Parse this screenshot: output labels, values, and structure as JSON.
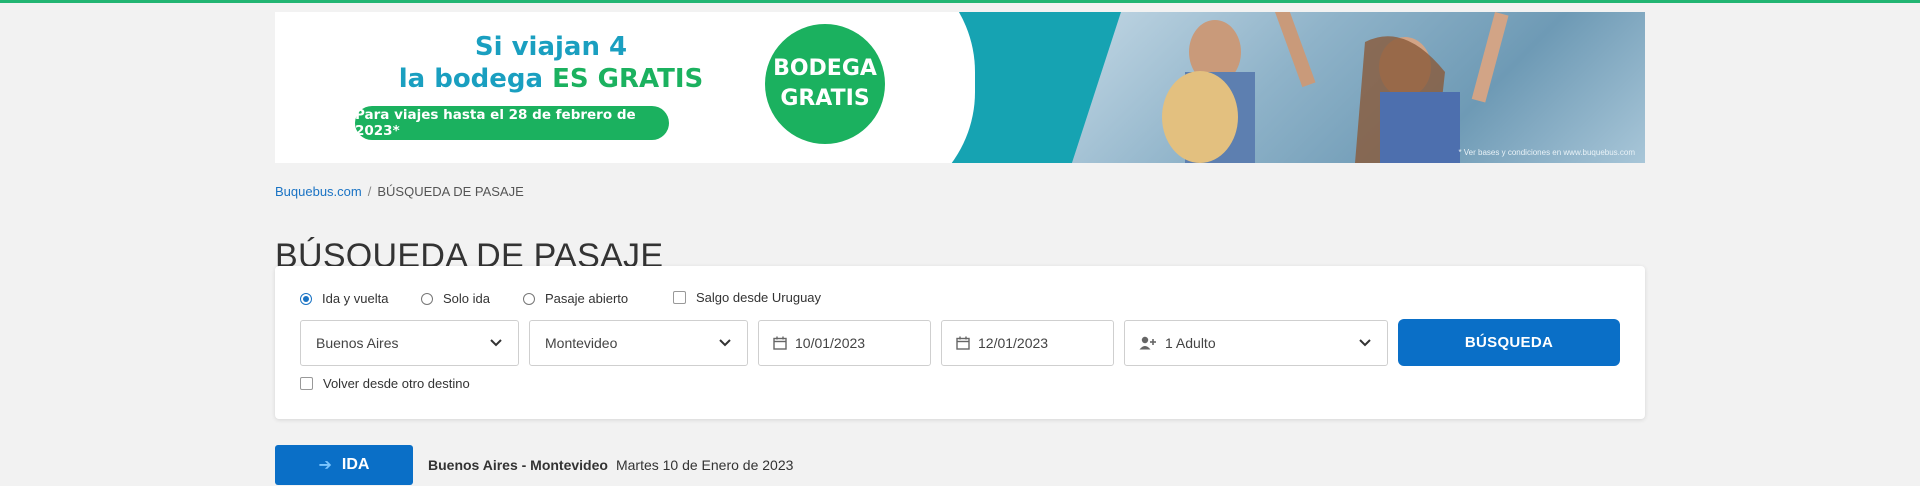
{
  "banner": {
    "line1": "Si viajan 4",
    "line2_a": "la bodega ",
    "line2_b": "ES GRATIS",
    "pill": "Para viajes hasta el 28 de febrero de 2023*",
    "badge_line1": "BODEGA",
    "badge_line2": "GRATIS",
    "fine_print": "* Ver bases y condiciones en www.buquebus.com"
  },
  "breadcrumb": {
    "home": "Buquebus.com",
    "separator": "/",
    "current": "BÚSQUEDA DE PASAJE"
  },
  "page_title": "BÚSQUEDA DE PASAJE",
  "search": {
    "trip_types": [
      {
        "label": "Ida y vuelta",
        "selected": true
      },
      {
        "label": "Solo ida",
        "selected": false
      },
      {
        "label": "Pasaje abierto",
        "selected": false
      }
    ],
    "from_uruguay_label": "Salgo desde Uruguay",
    "origin": "Buenos Aires",
    "destination": "Montevideo",
    "depart_date": "10/01/2023",
    "return_date": "12/01/2023",
    "passengers": "1 Adulto",
    "search_button": "BÚSQUEDA",
    "return_other_label": "Volver desde otro destino"
  },
  "outbound": {
    "button": "IDA",
    "route": "Buenos Aires - Montevideo",
    "date": "Martes 10 de Enero de 2023"
  },
  "colors": {
    "primary_blue": "#0a6fc7",
    "link_blue": "#1a73c4",
    "brand_green": "#1bb15f",
    "banner_teal": "#1a9fc0"
  }
}
